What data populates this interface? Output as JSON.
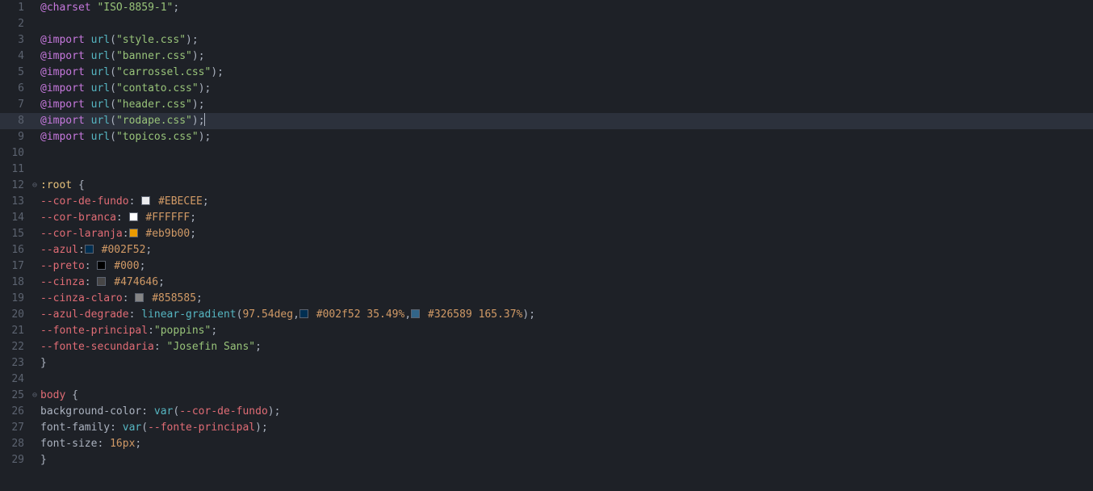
{
  "editor": {
    "highlightedLine": 8,
    "lines": [
      {
        "n": 1,
        "fold": "",
        "tokens": [
          [
            "atrule",
            "@charset"
          ],
          [
            "punc",
            " "
          ],
          [
            "string",
            "\"ISO-8859-1\""
          ],
          [
            "punc",
            ";"
          ]
        ]
      },
      {
        "n": 2,
        "fold": "",
        "tokens": []
      },
      {
        "n": 3,
        "fold": "",
        "tokens": [
          [
            "atrule",
            "@import"
          ],
          [
            "punc",
            " "
          ],
          [
            "func",
            "url"
          ],
          [
            "punc",
            "("
          ],
          [
            "string",
            "\"style.css\""
          ],
          [
            "punc",
            ")"
          ],
          [
            "punc",
            ";"
          ]
        ]
      },
      {
        "n": 4,
        "fold": "",
        "tokens": [
          [
            "atrule",
            "@import"
          ],
          [
            "punc",
            " "
          ],
          [
            "func",
            "url"
          ],
          [
            "punc",
            "("
          ],
          [
            "string",
            "\"banner.css\""
          ],
          [
            "punc",
            ")"
          ],
          [
            "punc",
            ";"
          ]
        ]
      },
      {
        "n": 5,
        "fold": "",
        "tokens": [
          [
            "atrule",
            "@import"
          ],
          [
            "punc",
            " "
          ],
          [
            "func",
            "url"
          ],
          [
            "punc",
            "("
          ],
          [
            "string",
            "\"carrossel.css\""
          ],
          [
            "punc",
            ")"
          ],
          [
            "punc",
            ";"
          ]
        ]
      },
      {
        "n": 6,
        "fold": "",
        "tokens": [
          [
            "atrule",
            "@import"
          ],
          [
            "punc",
            " "
          ],
          [
            "func",
            "url"
          ],
          [
            "punc",
            "("
          ],
          [
            "string",
            "\"contato.css\""
          ],
          [
            "punc",
            ")"
          ],
          [
            "punc",
            ";"
          ]
        ]
      },
      {
        "n": 7,
        "fold": "",
        "tokens": [
          [
            "atrule",
            "@import"
          ],
          [
            "punc",
            " "
          ],
          [
            "func",
            "url"
          ],
          [
            "punc",
            "("
          ],
          [
            "string",
            "\"header.css\""
          ],
          [
            "punc",
            ")"
          ],
          [
            "punc",
            ";"
          ]
        ]
      },
      {
        "n": 8,
        "fold": "",
        "tokens": [
          [
            "atrule",
            "@import"
          ],
          [
            "punc",
            " "
          ],
          [
            "func",
            "url"
          ],
          [
            "punc",
            "("
          ],
          [
            "string",
            "\"rodape.css\""
          ],
          [
            "punc",
            ")"
          ],
          [
            "punc",
            ";"
          ],
          [
            "cursor",
            ""
          ]
        ]
      },
      {
        "n": 9,
        "fold": "",
        "tokens": [
          [
            "atrule",
            "@import"
          ],
          [
            "punc",
            " "
          ],
          [
            "func",
            "url"
          ],
          [
            "punc",
            "("
          ],
          [
            "string",
            "\"topicos.css\""
          ],
          [
            "punc",
            ")"
          ],
          [
            "punc",
            ";"
          ]
        ]
      },
      {
        "n": 10,
        "fold": "",
        "tokens": []
      },
      {
        "n": 11,
        "fold": "",
        "tokens": []
      },
      {
        "n": 12,
        "fold": "⊖",
        "tokens": [
          [
            "selector",
            ":root"
          ],
          [
            "punc",
            " {"
          ]
        ]
      },
      {
        "n": 13,
        "fold": "",
        "tokens": [
          [
            "punc",
            "    "
          ],
          [
            "var",
            "--cor-de-fundo"
          ],
          [
            "punc",
            ": "
          ],
          [
            "swatch",
            "#EBECEE"
          ],
          [
            "punc",
            " "
          ],
          [
            "value",
            "#EBECEE"
          ],
          [
            "punc",
            ";"
          ]
        ]
      },
      {
        "n": 14,
        "fold": "",
        "tokens": [
          [
            "punc",
            "    "
          ],
          [
            "var",
            "--cor-branca"
          ],
          [
            "punc",
            ": "
          ],
          [
            "swatch",
            "#FFFFFF"
          ],
          [
            "punc",
            " "
          ],
          [
            "value",
            "#FFFFFF"
          ],
          [
            "punc",
            ";"
          ]
        ]
      },
      {
        "n": 15,
        "fold": "",
        "tokens": [
          [
            "punc",
            "    "
          ],
          [
            "var",
            "--cor-laranja"
          ],
          [
            "punc",
            ":"
          ],
          [
            "swatch",
            "#eb9b00"
          ],
          [
            "punc",
            " "
          ],
          [
            "value",
            "#eb9b00"
          ],
          [
            "punc",
            ";"
          ]
        ]
      },
      {
        "n": 16,
        "fold": "",
        "tokens": [
          [
            "punc",
            "    "
          ],
          [
            "var",
            "--azul"
          ],
          [
            "punc",
            ":"
          ],
          [
            "swatch",
            "#002F52"
          ],
          [
            "punc",
            " "
          ],
          [
            "value",
            "#002F52"
          ],
          [
            "punc",
            ";"
          ]
        ]
      },
      {
        "n": 17,
        "fold": "",
        "tokens": [
          [
            "punc",
            "    "
          ],
          [
            "var",
            "--preto"
          ],
          [
            "punc",
            ": "
          ],
          [
            "swatch",
            "#000000"
          ],
          [
            "punc",
            " "
          ],
          [
            "value",
            "#000"
          ],
          [
            "punc",
            ";"
          ]
        ]
      },
      {
        "n": 18,
        "fold": "",
        "tokens": [
          [
            "punc",
            "    "
          ],
          [
            "var",
            "--cinza"
          ],
          [
            "punc",
            ": "
          ],
          [
            "swatch",
            "#474646"
          ],
          [
            "punc",
            " "
          ],
          [
            "value",
            "#474646"
          ],
          [
            "punc",
            ";"
          ]
        ]
      },
      {
        "n": 19,
        "fold": "",
        "tokens": [
          [
            "punc",
            "    "
          ],
          [
            "var",
            "--cinza-claro"
          ],
          [
            "punc",
            ": "
          ],
          [
            "swatch",
            "#858585"
          ],
          [
            "punc",
            " "
          ],
          [
            "value",
            "#858585"
          ],
          [
            "punc",
            ";"
          ]
        ]
      },
      {
        "n": 20,
        "fold": "",
        "tokens": [
          [
            "punc",
            "    "
          ],
          [
            "var",
            "--azul-degrade"
          ],
          [
            "punc",
            ": "
          ],
          [
            "func",
            "linear-gradient"
          ],
          [
            "punc",
            "("
          ],
          [
            "number",
            "97.54deg"
          ],
          [
            "punc",
            ","
          ],
          [
            "swatch",
            "#002f52"
          ],
          [
            "punc",
            " "
          ],
          [
            "value",
            "#002f52"
          ],
          [
            "punc",
            " "
          ],
          [
            "number",
            "35.49%"
          ],
          [
            "punc",
            ","
          ],
          [
            "swatch",
            "#326589"
          ],
          [
            "punc",
            " "
          ],
          [
            "value",
            "#326589"
          ],
          [
            "punc",
            " "
          ],
          [
            "number",
            "165.37%"
          ],
          [
            "punc",
            ")"
          ],
          [
            "punc",
            ";"
          ]
        ]
      },
      {
        "n": 21,
        "fold": "",
        "tokens": [
          [
            "punc",
            "    "
          ],
          [
            "var",
            "--fonte-principal"
          ],
          [
            "punc",
            ":"
          ],
          [
            "string",
            "\"poppins\""
          ],
          [
            "punc",
            ";"
          ]
        ]
      },
      {
        "n": 22,
        "fold": "",
        "tokens": [
          [
            "punc",
            "    "
          ],
          [
            "var",
            "--fonte-secundaria"
          ],
          [
            "punc",
            ": "
          ],
          [
            "string",
            "\"Josefin Sans\""
          ],
          [
            "punc",
            ";"
          ]
        ]
      },
      {
        "n": 23,
        "fold": "",
        "tokens": [
          [
            "punc",
            "}"
          ]
        ]
      },
      {
        "n": 24,
        "fold": "",
        "tokens": []
      },
      {
        "n": 25,
        "fold": "⊖",
        "tokens": [
          [
            "selector2",
            "body"
          ],
          [
            "punc",
            " {"
          ]
        ]
      },
      {
        "n": 26,
        "fold": "",
        "tokens": [
          [
            "punc",
            "    "
          ],
          [
            "prop",
            "background-color"
          ],
          [
            "punc",
            ": "
          ],
          [
            "func",
            "var"
          ],
          [
            "punc",
            "("
          ],
          [
            "var",
            "--cor-de-fundo"
          ],
          [
            "punc",
            ")"
          ],
          [
            "punc",
            ";"
          ]
        ]
      },
      {
        "n": 27,
        "fold": "",
        "tokens": [
          [
            "punc",
            "    "
          ],
          [
            "prop",
            "font-family"
          ],
          [
            "punc",
            ": "
          ],
          [
            "func",
            "var"
          ],
          [
            "punc",
            "("
          ],
          [
            "var",
            "--fonte-principal"
          ],
          [
            "punc",
            ")"
          ],
          [
            "punc",
            ";"
          ]
        ]
      },
      {
        "n": 28,
        "fold": "",
        "tokens": [
          [
            "punc",
            "    "
          ],
          [
            "prop",
            "font-size"
          ],
          [
            "punc",
            ": "
          ],
          [
            "number",
            "16px"
          ],
          [
            "punc",
            ";"
          ]
        ]
      },
      {
        "n": 29,
        "fold": "",
        "tokens": [
          [
            "punc",
            "}"
          ]
        ]
      }
    ]
  }
}
